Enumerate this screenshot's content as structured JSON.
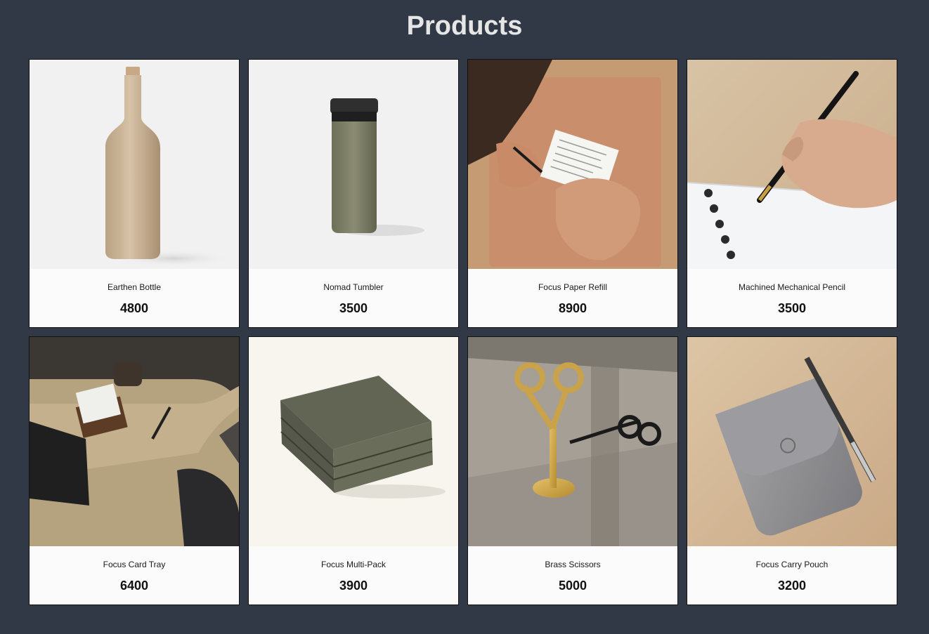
{
  "page": {
    "title": "Products",
    "background": "#313846"
  },
  "products": [
    {
      "name": "Earthen Bottle",
      "price": "4800",
      "image": "earthen-bottle-image"
    },
    {
      "name": "Nomad Tumbler",
      "price": "3500",
      "image": "nomad-tumbler-image"
    },
    {
      "name": "Focus Paper Refill",
      "price": "8900",
      "image": "focus-paper-refill-image"
    },
    {
      "name": "Machined Mechanical Pencil",
      "price": "3500",
      "image": "mechanical-pencil-image"
    },
    {
      "name": "Focus Card Tray",
      "price": "6400",
      "image": "focus-card-tray-image"
    },
    {
      "name": "Focus Multi-Pack",
      "price": "3900",
      "image": "focus-multi-pack-image"
    },
    {
      "name": "Brass Scissors",
      "price": "5000",
      "image": "brass-scissors-image"
    },
    {
      "name": "Focus Carry Pouch",
      "price": "3200",
      "image": "focus-carry-pouch-image"
    }
  ]
}
